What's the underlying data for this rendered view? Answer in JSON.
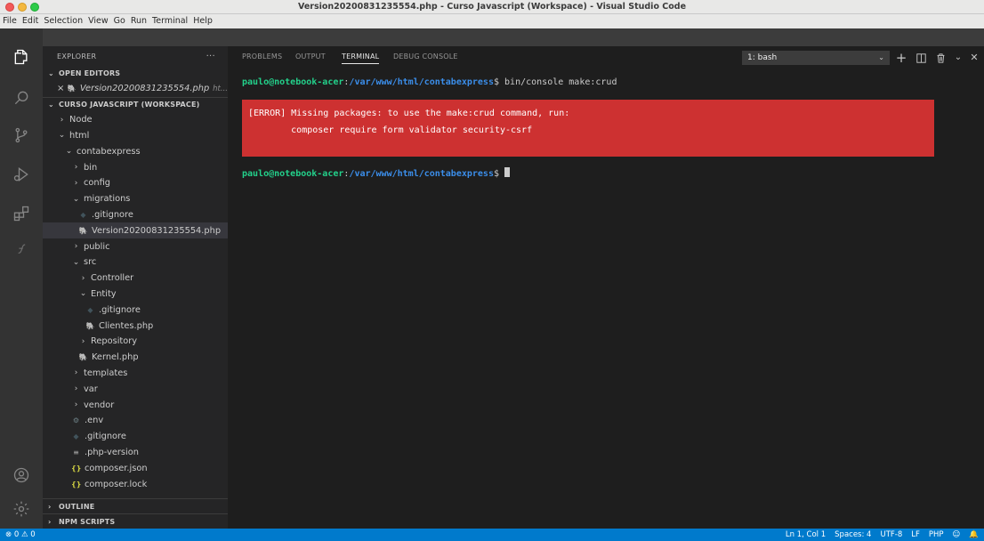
{
  "window": {
    "title": "Version20200831235554.php - Curso Javascript (Workspace) - Visual Studio Code"
  },
  "menu": [
    "File",
    "Edit",
    "Selection",
    "View",
    "Go",
    "Run",
    "Terminal",
    "Help"
  ],
  "activity_icons": [
    "explorer-icon",
    "search-icon",
    "source-control-icon",
    "run-debug-icon",
    "extensions-icon",
    "symfony-icon",
    "account-icon",
    "manage-gear-icon"
  ],
  "sidebar": {
    "header": "EXPLORER",
    "more": "···",
    "open_editors": {
      "title": "OPEN EDITORS",
      "items": [
        {
          "close": "×",
          "name": "Version20200831235554.php",
          "path": "ht..."
        }
      ]
    },
    "workspace": {
      "title": "CURSO JAVASCRIPT (WORKSPACE)",
      "tree": [
        {
          "depth": 0,
          "chev": "›",
          "icon": "",
          "label": "Node"
        },
        {
          "depth": 0,
          "chev": "⌄",
          "icon": "",
          "label": "html"
        },
        {
          "depth": 1,
          "chev": "⌄",
          "icon": "",
          "label": "contabexpress"
        },
        {
          "depth": 2,
          "chev": "›",
          "icon": "",
          "label": "bin"
        },
        {
          "depth": 2,
          "chev": "›",
          "icon": "",
          "label": "config"
        },
        {
          "depth": 2,
          "chev": "⌄",
          "icon": "",
          "label": "migrations"
        },
        {
          "depth": 3,
          "chev": "",
          "icon": "git",
          "label": ".gitignore"
        },
        {
          "depth": 3,
          "chev": "",
          "icon": "php",
          "label": "Version20200831235554.php",
          "selected": true
        },
        {
          "depth": 2,
          "chev": "›",
          "icon": "",
          "label": "public"
        },
        {
          "depth": 2,
          "chev": "⌄",
          "icon": "",
          "label": "src"
        },
        {
          "depth": 3,
          "chev": "›",
          "icon": "",
          "label": "Controller"
        },
        {
          "depth": 3,
          "chev": "⌄",
          "icon": "",
          "label": "Entity"
        },
        {
          "depth": 4,
          "chev": "",
          "icon": "git",
          "label": ".gitignore"
        },
        {
          "depth": 4,
          "chev": "",
          "icon": "php",
          "label": "Clientes.php"
        },
        {
          "depth": 3,
          "chev": "›",
          "icon": "",
          "label": "Repository"
        },
        {
          "depth": 3,
          "chev": "",
          "icon": "php",
          "label": "Kernel.php"
        },
        {
          "depth": 2,
          "chev": "›",
          "icon": "",
          "label": "templates"
        },
        {
          "depth": 2,
          "chev": "›",
          "icon": "",
          "label": "var"
        },
        {
          "depth": 2,
          "chev": "›",
          "icon": "",
          "label": "vendor"
        },
        {
          "depth": 2,
          "chev": "",
          "icon": "gear",
          "label": ".env"
        },
        {
          "depth": 2,
          "chev": "",
          "icon": "git",
          "label": ".gitignore"
        },
        {
          "depth": 2,
          "chev": "",
          "icon": "cfg",
          "label": ".php-version"
        },
        {
          "depth": 2,
          "chev": "",
          "icon": "json",
          "label": "composer.json"
        },
        {
          "depth": 2,
          "chev": "",
          "icon": "json",
          "label": "composer.lock"
        }
      ]
    },
    "outline": "OUTLINE",
    "npm_scripts": "NPM SCRIPTS"
  },
  "panel": {
    "tabs": [
      "PROBLEMS",
      "OUTPUT",
      "TERMINAL",
      "DEBUG CONSOLE"
    ],
    "active_tab": "TERMINAL",
    "terminal_select": "1: bash",
    "actions": [
      "new-terminal-icon",
      "split-terminal-icon",
      "kill-terminal-icon",
      "maximize-panel-icon",
      "close-panel-icon"
    ]
  },
  "terminal": {
    "user": "paulo@notebook-acer",
    "sep": ":",
    "path": "/var/www/html/contabexpress",
    "prompt": "$ ",
    "command": "bin/console make:crud",
    "error_line1": "[ERROR] Missing packages: to use the make:crud command, run:",
    "error_line2": "        composer require form validator security-csrf"
  },
  "status": {
    "errors": "0",
    "warnings": "0",
    "position": "Ln 1, Col 1",
    "spaces": "Spaces: 4",
    "encoding": "UTF-8",
    "eol": "LF",
    "language": "PHP"
  },
  "colors": {
    "statusbar": "#007acc",
    "error_bg": "#cd3131",
    "prompt_user": "#23d18b",
    "prompt_path": "#3b8eea"
  }
}
